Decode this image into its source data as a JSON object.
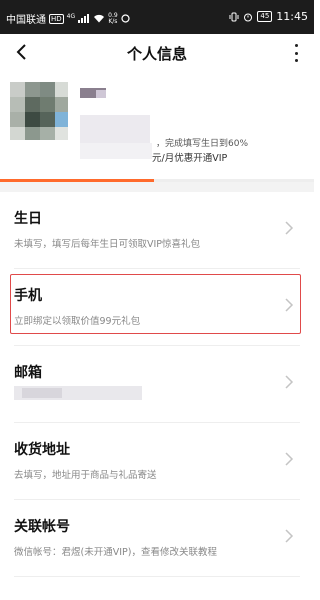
{
  "status_bar": {
    "carrier": "中国联通",
    "hd": "HD",
    "network": "4G",
    "speed_value": "0.9",
    "speed_unit": "K/s",
    "battery": "45",
    "time": "11:45"
  },
  "header": {
    "title": "个人信息"
  },
  "profile": {
    "completion_hint": "，完成填写生日到60%",
    "vip_hint": "元/月优惠开通VIP",
    "progress_fraction": 0.49
  },
  "rows": [
    {
      "label": "生日",
      "sub": "未填写，填写后每年生日可领取VIP惊喜礼包"
    },
    {
      "label": "手机",
      "sub": "立即绑定以领取价值99元礼包"
    },
    {
      "label": "邮箱",
      "sub": ""
    },
    {
      "label": "收货地址",
      "sub": "去填写，地址用于商品与礼品寄送"
    },
    {
      "label": "关联帐号",
      "sub": "微信帐号：君煜(未开通VIP)，查看修改关联教程"
    }
  ],
  "partial_row_label": "",
  "colors": {
    "accent": "#ff6a2c",
    "highlight": "#e04a4a"
  },
  "icons": [
    "back-arrow-icon",
    "more-vertical-icon",
    "chevron-right-icon",
    "wifi-icon",
    "signal-icon",
    "alarm-icon",
    "vibrate-icon"
  ]
}
